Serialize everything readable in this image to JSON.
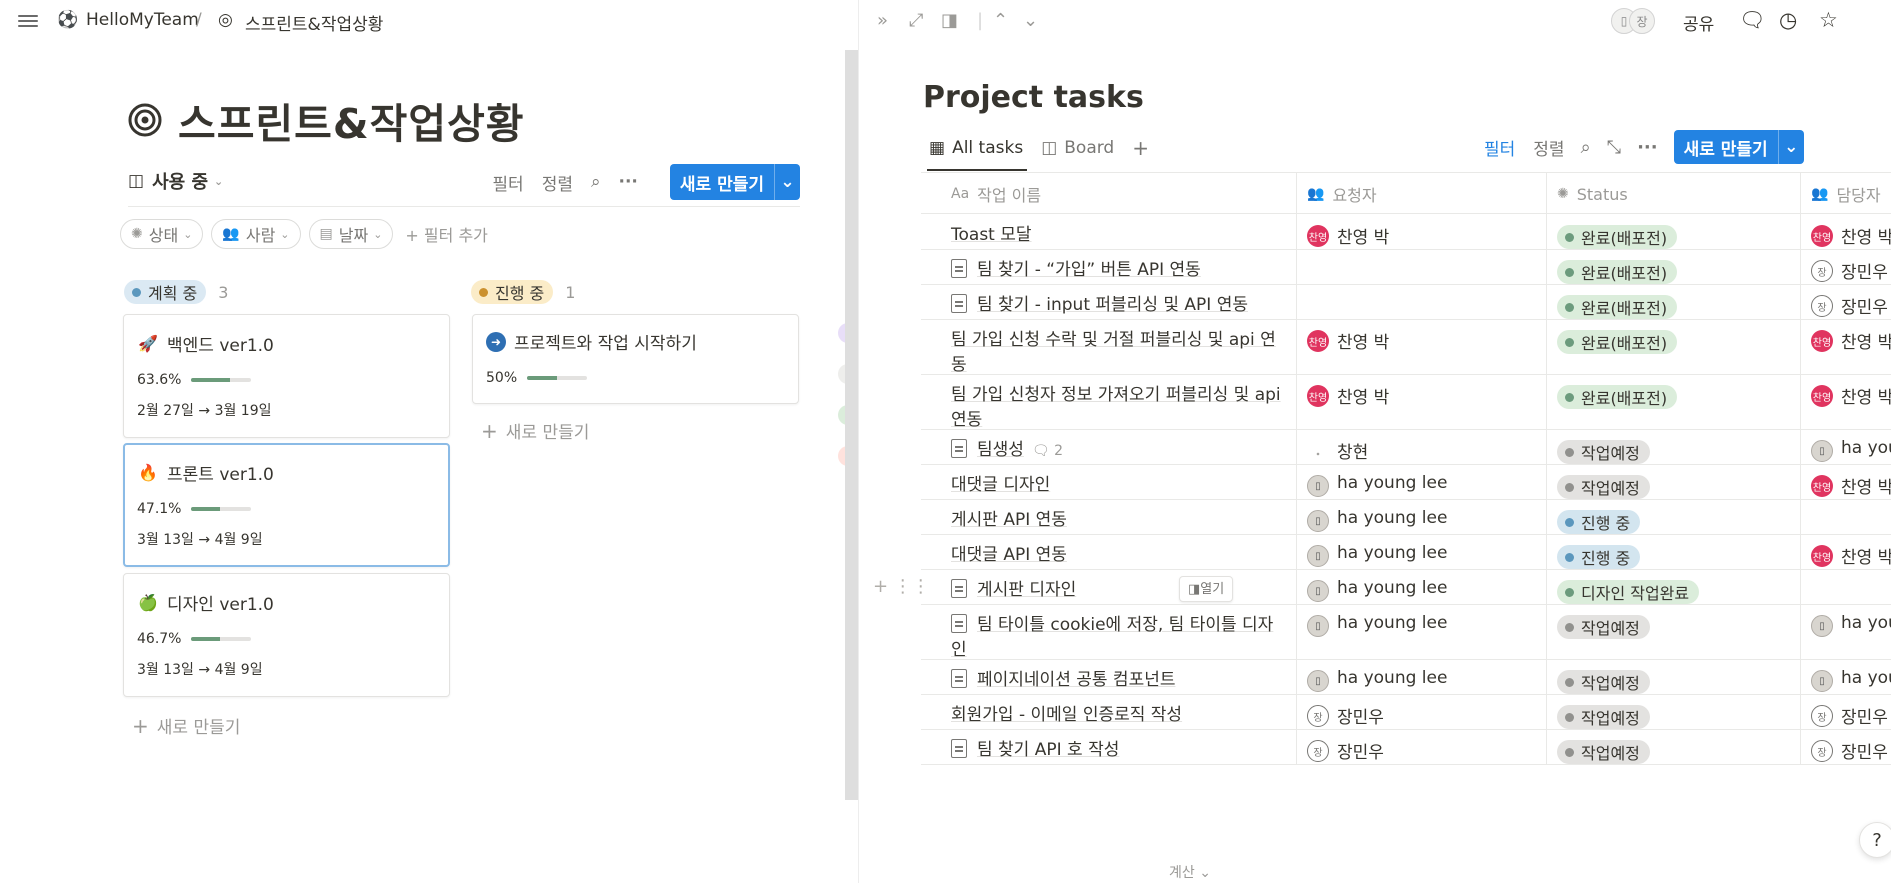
{
  "breadcrumb": {
    "workspace": "HelloMyTeam",
    "separator": "/",
    "page": "스프린트&작업상황"
  },
  "page_title": "스프린트&작업상황",
  "view": {
    "label": "사용 중",
    "filter": "필터",
    "sort": "정렬",
    "new_button": "새로 만들기"
  },
  "filters": [
    {
      "label": "상태",
      "icon": "status-icon"
    },
    {
      "label": "사람",
      "icon": "people-icon"
    },
    {
      "label": "날짜",
      "icon": "calendar-icon"
    }
  ],
  "add_filter": "필터 추가",
  "groups": [
    {
      "label": "계획 중",
      "count": "3",
      "color": "#5b97bd",
      "bg": "#dbe9f3"
    },
    {
      "label": "진행 중",
      "count": "1",
      "color": "#cb912f",
      "bg": "#fbecc8"
    }
  ],
  "cards": [
    {
      "icon": "🚀",
      "title": "백엔드 ver1.0",
      "progress_text": "63.6%",
      "progress": 0.636,
      "date": "2월 27일 → 3월 19일"
    },
    {
      "icon": "🔥",
      "title": "프론트 ver1.0",
      "progress_text": "47.1%",
      "progress": 0.471,
      "date": "3월 13일 → 4월 9일"
    },
    {
      "icon": "🍏",
      "title": "디자인 ver1.0",
      "progress_text": "46.7%",
      "progress": 0.467,
      "date": "3월 13일 → 4월 9일"
    },
    {
      "icon": "➜",
      "title": "프로젝트와 작업 시작하기",
      "progress_text": "50%",
      "progress": 0.5,
      "date": ""
    }
  ],
  "new_item": "새로 만들기",
  "right": {
    "share": "공유",
    "avatar_badge": "장",
    "db_title": "Project tasks",
    "tabs": [
      "All tasks",
      "Board"
    ],
    "actions": {
      "filter": "필터",
      "sort": "정렬",
      "new_button": "새로 만들기"
    },
    "columns": {
      "name_prefix": "Aa",
      "name": "작업 이름",
      "requester": "요청자",
      "status": "Status",
      "assignee": "담당자"
    },
    "rows": [
      {
        "name": "Toast 모달",
        "doc": false,
        "req": "찬영 박",
        "req_av": "red",
        "status": "완료(배포전)",
        "s": "done",
        "asg": "찬영 박",
        "asg_av": "red"
      },
      {
        "name": "팀 찾기 - “가입” 버튼 API 연동",
        "doc": true,
        "req": "",
        "req_av": "",
        "status": "완료(배포전)",
        "s": "done",
        "asg": "장민우",
        "asg_av": "outline"
      },
      {
        "name": "팀 찾기 - input 퍼블리싱 및 API 연동",
        "doc": true,
        "req": "",
        "req_av": "",
        "status": "완료(배포전)",
        "s": "done",
        "asg": "장민우",
        "asg_av": "outline"
      },
      {
        "name": "팀 가입 신청 수락 및 거절 퍼블리싱 및 api 연동",
        "doc": false,
        "req": "찬영 박",
        "req_av": "red",
        "status": "완료(배포전)",
        "s": "done",
        "asg": "찬영 박",
        "asg_av": "red"
      },
      {
        "name": "팀 가입 신청자 정보 가져오기 퍼블리싱 및 api 연동",
        "doc": false,
        "req": "찬영 박",
        "req_av": "red",
        "status": "완료(배포전)",
        "s": "done",
        "asg": "찬영 박",
        "asg_av": "red"
      },
      {
        "name": "팀생성",
        "doc": true,
        "comments": "2",
        "req": "창현",
        "req_av": "none",
        "status": "작업예정",
        "s": "todo",
        "asg": "ha young lee",
        "asg_av": "photo"
      },
      {
        "name": "대댓글 디자인",
        "doc": false,
        "req": "ha young lee",
        "req_av": "photo",
        "status": "작업예정",
        "s": "todo",
        "asg": "찬영 박",
        "asg_av": "red"
      },
      {
        "name": "게시판 API 연동",
        "doc": false,
        "req": "ha young lee",
        "req_av": "photo",
        "status": "진행 중",
        "s": "prog",
        "asg": "",
        "asg_av": ""
      },
      {
        "name": "대댓글 API 연동",
        "doc": false,
        "req": "ha young lee",
        "req_av": "photo",
        "status": "진행 중",
        "s": "prog",
        "asg": "찬영 박",
        "asg_av": "red"
      },
      {
        "name": "게시판 디자인",
        "doc": true,
        "open": "열기",
        "req": "ha young lee",
        "req_av": "photo",
        "status": "디자인 작업완료",
        "s": "done",
        "asg": "",
        "asg_av": ""
      },
      {
        "name": "팀 타이틀 cookie에 저장, 팀 타이틀 디자인",
        "doc": true,
        "req": "ha young lee",
        "req_av": "photo",
        "status": "작업예정",
        "s": "todo",
        "asg": "ha young lee",
        "asg_av": "photo"
      },
      {
        "name": "페이지네이션 공통 컴포넌트",
        "doc": true,
        "req": "ha young lee",
        "req_av": "photo",
        "status": "작업예정",
        "s": "todo",
        "asg": "ha young lee",
        "asg_av": "photo"
      },
      {
        "name": "회원가입 - 이메일 인증로직 작성",
        "doc": false,
        "req": "장민우",
        "req_av": "outline",
        "status": "작업예정",
        "s": "todo",
        "asg": "장민우",
        "asg_av": "outline"
      },
      {
        "name": "팀 찾기 API 호 작성",
        "doc": true,
        "req": "장민우",
        "req_av": "outline",
        "status": "작업예정",
        "s": "todo",
        "asg": "장민우",
        "asg_av": "outline"
      }
    ],
    "status_colors": {
      "done": {
        "bg": "#dbeddb",
        "dot": "#6c9b7d"
      },
      "todo": {
        "bg": "#e3e2e0",
        "dot": "#91918e"
      },
      "prog": {
        "bg": "#d3e5ef",
        "dot": "#5b97bd"
      }
    },
    "avatar_initials": {
      "red": "찬영",
      "outline": "장",
      "photo": "▯",
      "none": "𝆺"
    },
    "calc": "계산",
    "help": "?"
  }
}
